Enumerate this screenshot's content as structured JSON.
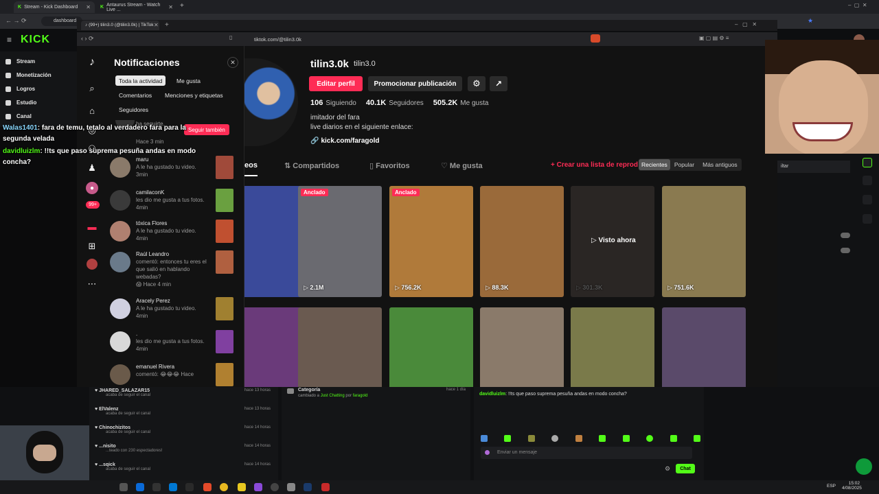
{
  "outer_browser": {
    "tabs": [
      {
        "label": "Stream - Kick Dashboard"
      },
      {
        "label": "Antaurus Stream - Watch Live ..."
      }
    ],
    "address": "dashboard"
  },
  "kick": {
    "logo": "KICK",
    "sidebar": [
      {
        "label": "Stream"
      },
      {
        "label": "Monetización"
      },
      {
        "label": "Logros"
      },
      {
        "label": "Estudio"
      },
      {
        "label": "Canal"
      }
    ],
    "chat_overlay": [
      {
        "user": "Walas1401",
        "text": "fara de temu, tetalo al verdadero fara para la segunda velada"
      },
      {
        "user": "davidluizlm",
        "text": "!!ts que paso suprema pesuña andas en modo concha?"
      }
    ],
    "activity": [
      {
        "user": "JHARED_SALAZAR15",
        "action": "acaba de seguir el canal",
        "time": "hace 13 horas"
      },
      {
        "user": "ElValenz",
        "action": "acaba de seguir el canal",
        "time": "hace 13 horas"
      },
      {
        "user": "Chinochizitos",
        "action": "acaba de seguir el canal",
        "time": "hace 14 horas"
      },
      {
        "user": "...nisito",
        "action": "...teado con 230 espectadores!",
        "time": "hace 14 horas"
      },
      {
        "user": "...sqick",
        "action": "acaba de seguir el canal",
        "time": "hace 14 horas"
      }
    ],
    "category_event": {
      "title": "Categoría",
      "text_prefix": "cambiado a",
      "category": "Just Chatting",
      "by": "por",
      "user": "faragold",
      "time": "hace 1 día"
    },
    "chat_message": {
      "user": "davidluizlm",
      "text": "!!ts que paso suprema pesuña andas en modo concha?"
    },
    "chat_placeholder": "Enviar un mensaje",
    "chat_button": "Chat",
    "right_filter": "iltar"
  },
  "inner_browser": {
    "tab_label": "(99+) tilin3.0 (@tilin3.0k) | TikTok",
    "url": "tiktok.com/@tilin3.0k"
  },
  "notifications": {
    "title": "Notificaciones",
    "filters": [
      "Toda la actividad",
      "Me gusta",
      "Comentarios",
      "Menciones y etiquetas",
      "Seguidores"
    ],
    "partial_item": {
      "text": "ha seguirte.",
      "time": "Hace 3 min",
      "button": "Seguir también"
    },
    "items": [
      {
        "user": "maru",
        "text": "A le ha gustado tu video.",
        "time": "3min",
        "avatar": "#8a7a6a",
        "thumb": "#a04a3a"
      },
      {
        "user": "camilaconK",
        "text": "les dio me gusta a tus fotos.",
        "time": "4min",
        "avatar": "#3a3a3a",
        "thumb": "#6aa040"
      },
      {
        "user": "tóxica Flores",
        "text": "A le ha gustado tu video.",
        "time": "4min",
        "avatar": "#b08070",
        "thumb": "#c05030"
      },
      {
        "user": "Raúl Leandro",
        "text": "comentó: entonces tu eres el que salió en hablando webadas?",
        "time": "😱 Hace 4 min",
        "avatar": "#6a7a8a",
        "thumb": "#b06040"
      },
      {
        "user": "Aracely Perez",
        "text": "A le ha gustado tu video.",
        "time": "4min",
        "avatar": "#d0d0e0",
        "thumb": "#a08030"
      },
      {
        "user": ".",
        "text": "les dio me gusta a tus fotos.",
        "time": "4min",
        "avatar": "#d8d8d8",
        "thumb": "#8040a0"
      },
      {
        "user": "emanuel Rivera",
        "text": "comentó: 😂😂😂 Hace",
        "time": "",
        "avatar": "#6a5a4a",
        "thumb": "#b08030"
      }
    ]
  },
  "profile": {
    "username": "tilin3.0k",
    "nickname": "tilin3.0",
    "edit_button": "Editar perfil",
    "promote_button": "Promocionar publicación",
    "following_count": "106",
    "following_label": "Siguiendo",
    "followers_count": "40.1K",
    "followers_label": "Seguidores",
    "likes_count": "505.2K",
    "likes_label": "Me gusta",
    "bio_line1": "imitador del fara",
    "bio_line2": "live diarios en el siguiente enlace:",
    "link": "kick.com/faragold",
    "tabs": [
      "eos",
      "Compartidos",
      "Favoritos",
      "Me gusta"
    ],
    "create_list": "+ Crear una lista de reprod",
    "sort": [
      "Recientes",
      "Popular",
      "Más antiguos"
    ],
    "videos_row1": [
      {
        "views": "",
        "pinned": "",
        "color": "#3a4a9a"
      },
      {
        "views": "2.1M",
        "pinned": "Anclado",
        "color": "#6a6a70"
      },
      {
        "views": "756.2K",
        "pinned": "Anclado",
        "color": "#b07a3a"
      },
      {
        "views": "88.3K",
        "pinned": "",
        "color": "#9a6a3a"
      },
      {
        "views": "301.3K",
        "pinned": "",
        "color": "#2a2624",
        "overlay": "▷ Visto ahora"
      },
      {
        "views": "751.6K",
        "pinned": "",
        "color": "#8a7a50"
      }
    ],
    "videos_row2": [
      {
        "color": "#6a3a7a"
      },
      {
        "color": "#6a5a50"
      },
      {
        "color": "#4a8a3a"
      },
      {
        "color": "#8a7a6a"
      },
      {
        "color": "#7a7a4a"
      },
      {
        "color": "#5a4a6a"
      }
    ]
  },
  "taskbar": {
    "lang": "ESP",
    "time": "15:02",
    "date": "4/08/2025"
  },
  "colors": {
    "kick_green": "#53fc18",
    "tiktok_red": "#fe2c55"
  }
}
